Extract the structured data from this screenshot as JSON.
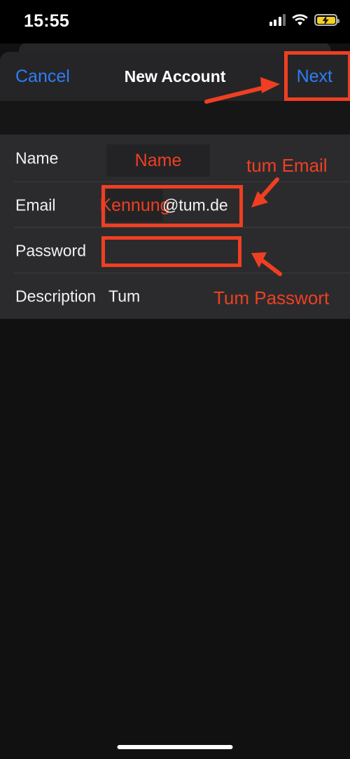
{
  "status_bar": {
    "time": "15:55",
    "cellular_icon": "cellular-bars-icon",
    "wifi_icon": "wifi-icon",
    "battery_icon": "battery-charging-icon",
    "battery_color": "#f5d020"
  },
  "nav": {
    "cancel_label": "Cancel",
    "title": "New Account",
    "next_label": "Next",
    "tint_color": "#2f7cf6"
  },
  "form": {
    "rows": [
      {
        "label": "Name",
        "value": "",
        "redacted_text": "Name",
        "redacted": true
      },
      {
        "label": "Email",
        "value": "@tum.de",
        "redacted_text": "Kennung",
        "redacted": true
      },
      {
        "label": "Password",
        "value": "",
        "redacted_text": "",
        "redacted": false
      },
      {
        "label": "Description",
        "value": "Tum",
        "redacted_text": "",
        "redacted": false
      }
    ]
  },
  "annotations": {
    "color": "#ef3f22",
    "labels": [
      {
        "text": "tum Email"
      },
      {
        "text": "Tum Passwort"
      }
    ],
    "boxes": [
      {
        "name": "next-button-highlight"
      },
      {
        "name": "email-field-highlight"
      },
      {
        "name": "password-field-highlight"
      }
    ],
    "arrows": [
      {
        "name": "arrow-to-next-button"
      },
      {
        "name": "arrow-to-email-field"
      },
      {
        "name": "arrow-to-password-field"
      }
    ]
  },
  "home_indicator": {
    "name": "home-indicator"
  }
}
